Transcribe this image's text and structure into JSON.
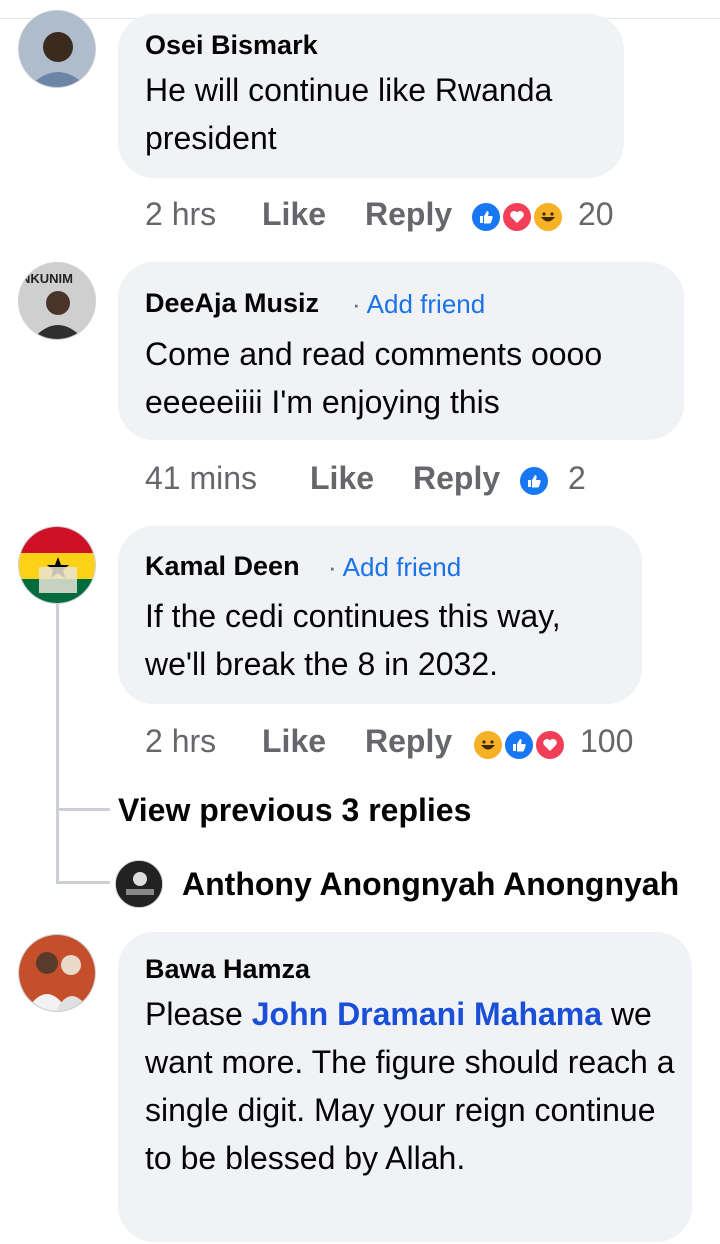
{
  "comments": [
    {
      "author": "Osei Bismark",
      "text": "He will continue like Rwanda president",
      "time": "2 hrs",
      "like_label": "Like",
      "reply_label": "Reply",
      "reaction_count": "20",
      "reactions": [
        "like",
        "love",
        "haha"
      ]
    },
    {
      "author": "DeeAja Musiz",
      "add_friend": "Add friend",
      "text": "Come and read comments oooo eeeeeiiii I'm enjoying this",
      "time": "41 mins",
      "like_label": "Like",
      "reply_label": "Reply",
      "reaction_count": "2",
      "reactions": [
        "like"
      ],
      "avatar_overlay_text": "NKUNIM"
    },
    {
      "author": "Kamal Deen",
      "add_friend": "Add friend",
      "text": "If the cedi continues this way, we'll break the 8 in 2032.",
      "time": "2 hrs",
      "like_label": "Like",
      "reply_label": "Reply",
      "reaction_count": "100",
      "reactions": [
        "haha",
        "like",
        "love"
      ]
    },
    {
      "author": "Bawa Hamza",
      "text_prefix": "Please ",
      "mention": "John Dramani Mahama",
      "text_suffix": " we want more. The figure should reach a single digit. May your reign continue to be blessed by Allah."
    }
  ],
  "replies": {
    "view_previous": "View previous 3 replies",
    "last_reply_author": "Anthony Anongnyah Anongnyah"
  },
  "colors": {
    "bubble": "#f0f2f5",
    "meta_text": "#65676b",
    "add_friend": "#1a73e8",
    "mention": "#1a4fd8",
    "like": "#1877f2",
    "love": "#f33e58",
    "haha": "#f7b125"
  }
}
